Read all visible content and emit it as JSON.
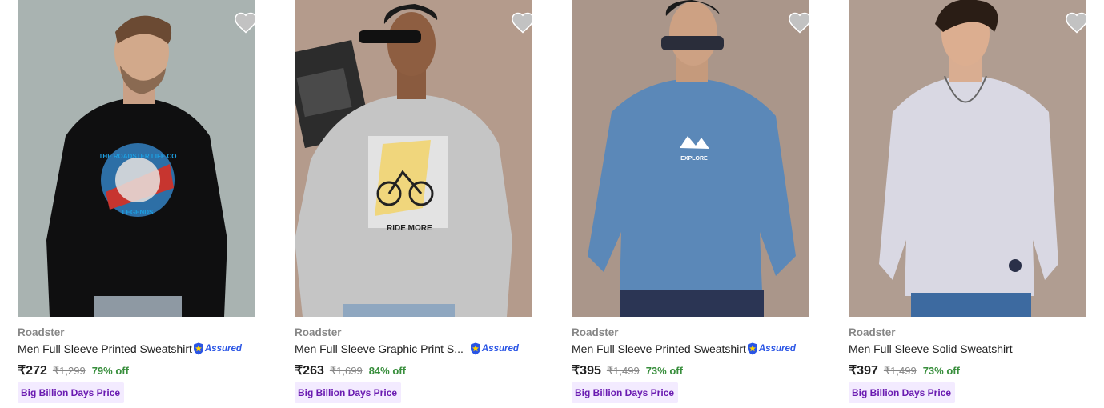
{
  "products": [
    {
      "brand": "Roadster",
      "title": "Men Full Sleeve Printed Sweatshirt",
      "assured": "Assured",
      "price": "₹272",
      "mrp": "₹1,299",
      "discount": "79% off",
      "badge": "Big Billion Days Price",
      "print_text": "THE ROADSTER LIFE CO",
      "print_text2": "LEGENDS",
      "bg_color": "#a9b3b1",
      "shirt_color": "#0f0f10"
    },
    {
      "brand": "Roadster",
      "title": "Men Full Sleeve Graphic Print S...",
      "assured": "Assured",
      "price": "₹263",
      "mrp": "₹1,699",
      "discount": "84% off",
      "badge": "Big Billion Days Price",
      "print_text": "RIDE MORE",
      "bg_color": "#b49b8c",
      "shirt_color": "#c5c5c5"
    },
    {
      "brand": "Roadster",
      "title": "Men Full Sleeve Printed Sweatshirt",
      "assured": "Assured",
      "price": "₹395",
      "mrp": "₹1,499",
      "discount": "73% off",
      "badge": "Big Billion Days Price",
      "print_text": "EXPLORE",
      "bg_color": "#aa968a",
      "shirt_color": "#5b88b8"
    },
    {
      "brand": "Roadster",
      "title": "Men Full Sleeve Solid Sweatshirt",
      "price": "₹397",
      "mrp": "₹1,499",
      "discount": "73% off",
      "badge": "Big Billion Days Price",
      "bg_color": "#b09d91",
      "shirt_color": "#d9d8e3"
    }
  ],
  "icons": {
    "wishlist": "heart-icon",
    "assured": "assured-shield-icon"
  },
  "colors": {
    "discount": "#388e3c",
    "badge_bg": "#f3ebff",
    "badge_text": "#6a1bb1",
    "assured": "#2a55e5"
  }
}
